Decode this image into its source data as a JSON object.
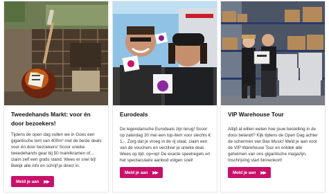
{
  "cards": [
    {
      "title": "Tweedehands Markt: voor én door bezoekers!",
      "description": "Tijdens de open dag vullen we in Goes een gigantische tent van 400m² met de beste deals: voor én door bezoekers! Scoor unieke tweedehands gear bij 50 marktkramen of… claim zelf een gratis stand. Wees er snel bij! Bekijk alle info en schrijf je direct in.",
      "button_label": "Meld je aan",
      "image_alt": "Electric guitar in front of a stack of amplifiers"
    },
    {
      "title": "Eurodeals",
      "description": "De legendarische Eurodeals zijn terug! Scoor op zaterdag 30 mei een top-item voor slechts € 1,-. Zorg dat je vroeg in de rij staat, claim een van de vouchers en verzilver je unieke deal. Wees op tijd: op=op! De exacte speelregels en het spectaculaire aanbod volgen snel!",
      "button_label": "Meld je aan",
      "image_alt": "Two smiling people holding Eurodeals signs"
    },
    {
      "title": "VIP Warehouse Tour",
      "description": "Altijd al willen weten hoe jouw bestelling in de doos belandt? Kijk tijdens de Open Dag achter de schermen van Bax Music! Meld je aan voor de VIP Warehouse Tour en ontdek alle geheimen van ons gigantische magazijn. Inschrijving start binnenkort!",
      "button_label": "Meld je aan",
      "image_alt": "Two people in a warehouse with shelves of boxes"
    }
  ],
  "colors": {
    "accent": "#c8116a"
  },
  "icons": {
    "button_arrow": "double-chevron-right-icon"
  }
}
